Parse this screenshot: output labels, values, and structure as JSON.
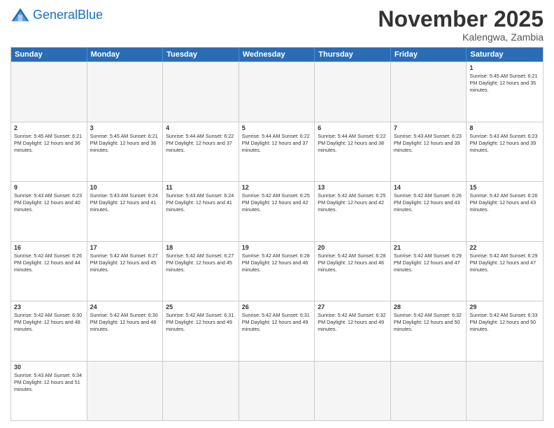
{
  "header": {
    "logo_general": "General",
    "logo_blue": "Blue",
    "month_title": "November 2025",
    "location": "Kalengwa, Zambia"
  },
  "weekdays": [
    "Sunday",
    "Monday",
    "Tuesday",
    "Wednesday",
    "Thursday",
    "Friday",
    "Saturday"
  ],
  "rows": [
    [
      {
        "day": "",
        "info": ""
      },
      {
        "day": "",
        "info": ""
      },
      {
        "day": "",
        "info": ""
      },
      {
        "day": "",
        "info": ""
      },
      {
        "day": "",
        "info": ""
      },
      {
        "day": "",
        "info": ""
      },
      {
        "day": "1",
        "info": "Sunrise: 5:45 AM\nSunset: 6:21 PM\nDaylight: 12 hours and 35 minutes."
      }
    ],
    [
      {
        "day": "2",
        "info": "Sunrise: 5:45 AM\nSunset: 6:21 PM\nDaylight: 12 hours and 36 minutes."
      },
      {
        "day": "3",
        "info": "Sunrise: 5:45 AM\nSunset: 6:21 PM\nDaylight: 12 hours and 36 minutes."
      },
      {
        "day": "4",
        "info": "Sunrise: 5:44 AM\nSunset: 6:22 PM\nDaylight: 12 hours and 37 minutes."
      },
      {
        "day": "5",
        "info": "Sunrise: 5:44 AM\nSunset: 6:22 PM\nDaylight: 12 hours and 37 minutes."
      },
      {
        "day": "6",
        "info": "Sunrise: 5:44 AM\nSunset: 6:22 PM\nDaylight: 12 hours and 38 minutes."
      },
      {
        "day": "7",
        "info": "Sunrise: 5:43 AM\nSunset: 6:23 PM\nDaylight: 12 hours and 39 minutes."
      },
      {
        "day": "8",
        "info": "Sunrise: 5:43 AM\nSunset: 6:23 PM\nDaylight: 12 hours and 39 minutes."
      }
    ],
    [
      {
        "day": "9",
        "info": "Sunrise: 5:43 AM\nSunset: 6:23 PM\nDaylight: 12 hours and 40 minutes."
      },
      {
        "day": "10",
        "info": "Sunrise: 5:43 AM\nSunset: 6:24 PM\nDaylight: 12 hours and 41 minutes."
      },
      {
        "day": "11",
        "info": "Sunrise: 5:43 AM\nSunset: 6:24 PM\nDaylight: 12 hours and 41 minutes."
      },
      {
        "day": "12",
        "info": "Sunrise: 5:42 AM\nSunset: 6:25 PM\nDaylight: 12 hours and 42 minutes."
      },
      {
        "day": "13",
        "info": "Sunrise: 5:42 AM\nSunset: 6:25 PM\nDaylight: 12 hours and 42 minutes."
      },
      {
        "day": "14",
        "info": "Sunrise: 5:42 AM\nSunset: 6:26 PM\nDaylight: 12 hours and 43 minutes."
      },
      {
        "day": "15",
        "info": "Sunrise: 5:42 AM\nSunset: 6:26 PM\nDaylight: 12 hours and 43 minutes."
      }
    ],
    [
      {
        "day": "16",
        "info": "Sunrise: 5:42 AM\nSunset: 6:26 PM\nDaylight: 12 hours and 44 minutes."
      },
      {
        "day": "17",
        "info": "Sunrise: 5:42 AM\nSunset: 6:27 PM\nDaylight: 12 hours and 45 minutes."
      },
      {
        "day": "18",
        "info": "Sunrise: 5:42 AM\nSunset: 6:27 PM\nDaylight: 12 hours and 45 minutes."
      },
      {
        "day": "19",
        "info": "Sunrise: 5:42 AM\nSunset: 6:28 PM\nDaylight: 12 hours and 46 minutes."
      },
      {
        "day": "20",
        "info": "Sunrise: 5:42 AM\nSunset: 6:28 PM\nDaylight: 12 hours and 46 minutes."
      },
      {
        "day": "21",
        "info": "Sunrise: 5:42 AM\nSunset: 6:29 PM\nDaylight: 12 hours and 47 minutes."
      },
      {
        "day": "22",
        "info": "Sunrise: 5:42 AM\nSunset: 6:29 PM\nDaylight: 12 hours and 47 minutes."
      }
    ],
    [
      {
        "day": "23",
        "info": "Sunrise: 5:42 AM\nSunset: 6:30 PM\nDaylight: 12 hours and 48 minutes."
      },
      {
        "day": "24",
        "info": "Sunrise: 5:42 AM\nSunset: 6:30 PM\nDaylight: 12 hours and 48 minutes."
      },
      {
        "day": "25",
        "info": "Sunrise: 5:42 AM\nSunset: 6:31 PM\nDaylight: 12 hours and 49 minutes."
      },
      {
        "day": "26",
        "info": "Sunrise: 5:42 AM\nSunset: 6:31 PM\nDaylight: 12 hours and 49 minutes."
      },
      {
        "day": "27",
        "info": "Sunrise: 5:42 AM\nSunset: 6:32 PM\nDaylight: 12 hours and 49 minutes."
      },
      {
        "day": "28",
        "info": "Sunrise: 5:42 AM\nSunset: 6:32 PM\nDaylight: 12 hours and 50 minutes."
      },
      {
        "day": "29",
        "info": "Sunrise: 5:42 AM\nSunset: 6:33 PM\nDaylight: 12 hours and 50 minutes."
      }
    ],
    [
      {
        "day": "30",
        "info": "Sunrise: 5:43 AM\nSunset: 6:34 PM\nDaylight: 12 hours and 51 minutes."
      },
      {
        "day": "",
        "info": ""
      },
      {
        "day": "",
        "info": ""
      },
      {
        "day": "",
        "info": ""
      },
      {
        "day": "",
        "info": ""
      },
      {
        "day": "",
        "info": ""
      },
      {
        "day": "",
        "info": ""
      }
    ]
  ]
}
